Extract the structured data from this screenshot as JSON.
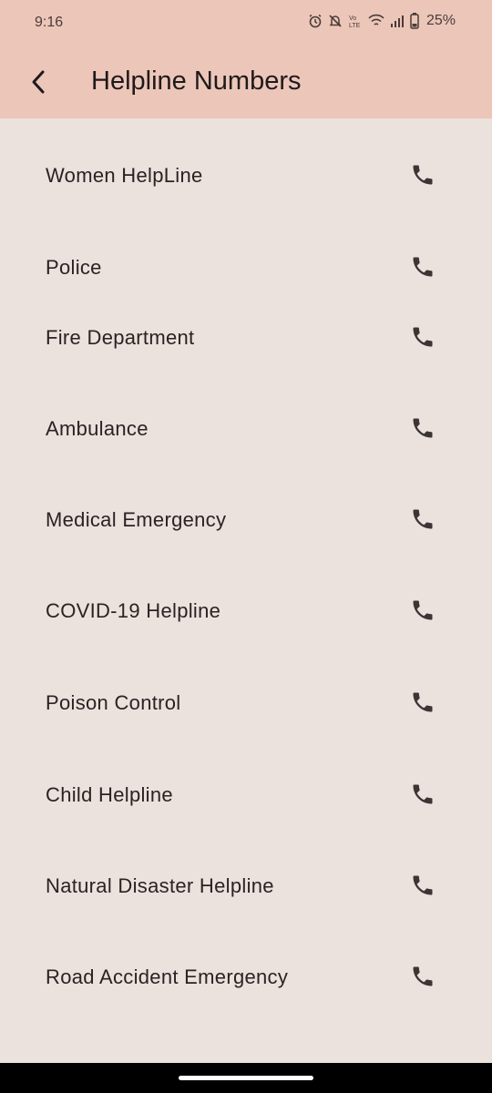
{
  "status_bar": {
    "time": "9:16",
    "battery": "25%",
    "icons": [
      "alarm-icon",
      "mute-icon",
      "volte-icon",
      "wifi-icon",
      "signal-icon",
      "battery-icon"
    ]
  },
  "app_bar": {
    "title": "Helpline Numbers",
    "back_icon": "chevron-left-icon"
  },
  "helplines": [
    {
      "label": "Women HelpLine",
      "icon": "phone-icon"
    },
    {
      "label": "Police",
      "icon": "phone-icon"
    },
    {
      "label": "Fire Department",
      "icon": "phone-icon"
    },
    {
      "label": "Ambulance",
      "icon": "phone-icon"
    },
    {
      "label": "Medical Emergency",
      "icon": "phone-icon"
    },
    {
      "label": "COVID-19 Helpline",
      "icon": "phone-icon"
    },
    {
      "label": "Poison Control",
      "icon": "phone-icon"
    },
    {
      "label": "Child Helpline",
      "icon": "phone-icon"
    },
    {
      "label": "Natural Disaster Helpline",
      "icon": "phone-icon"
    },
    {
      "label": "Road Accident Emergency",
      "icon": "phone-icon"
    }
  ],
  "colors": {
    "app_bar": "#ecc6b9",
    "background": "#ebe1dd",
    "text": "#2a2323",
    "icon": "#3b3535"
  }
}
